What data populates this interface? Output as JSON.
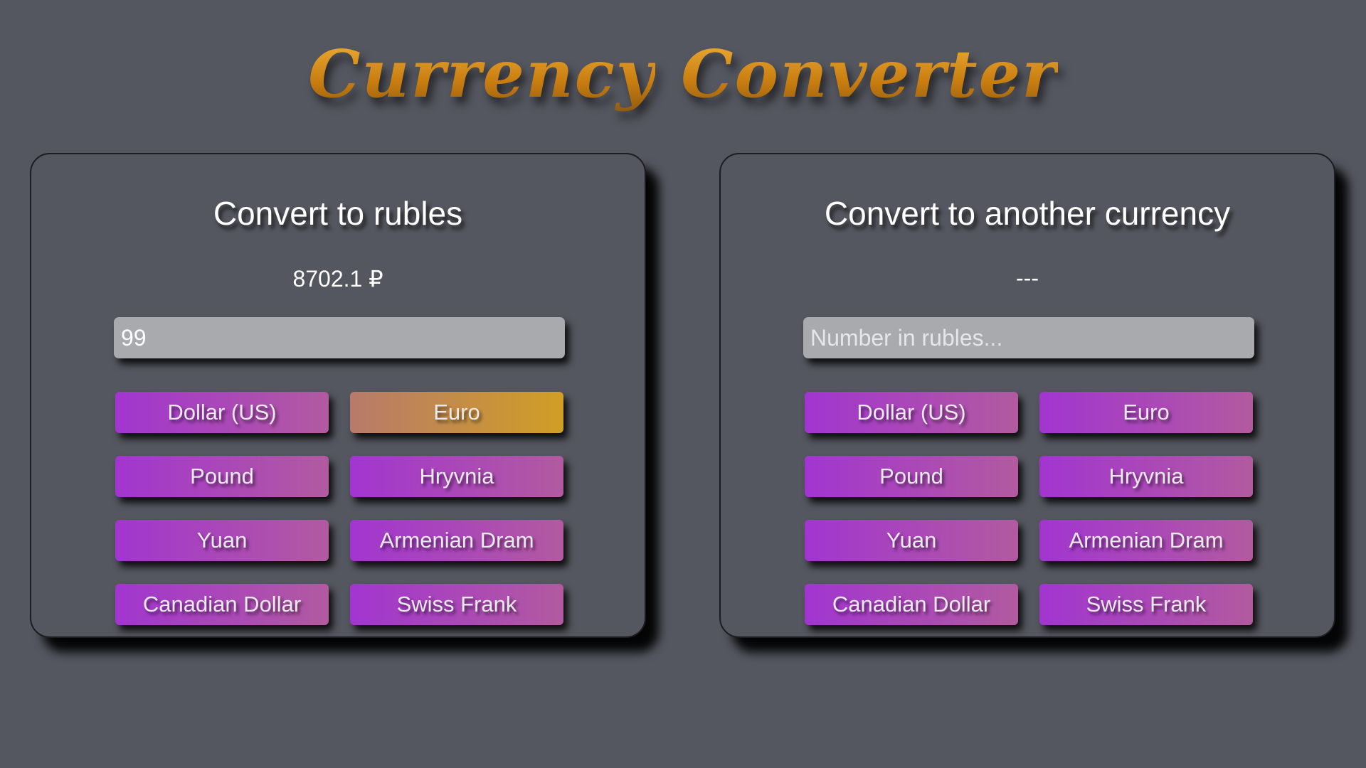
{
  "app": {
    "title_word1": "Currency",
    "title_word2": "Converter"
  },
  "to_rubles": {
    "heading": "Convert to rubles",
    "result": "8702.1 ₽",
    "input_value": "99",
    "input_placeholder": "",
    "buttons": [
      {
        "label": "Dollar (US)"
      },
      {
        "label": "Euro",
        "selected": true
      },
      {
        "label": "Pound"
      },
      {
        "label": "Hryvnia"
      },
      {
        "label": "Yuan"
      },
      {
        "label": "Armenian Dram"
      },
      {
        "label": "Canadian Dollar"
      },
      {
        "label": "Swiss Frank"
      }
    ]
  },
  "to_other": {
    "heading": "Convert to another currency",
    "result": "---",
    "input_value": "",
    "input_placeholder": "Number in rubles...",
    "buttons": [
      {
        "label": "Dollar (US)"
      },
      {
        "label": "Euro"
      },
      {
        "label": "Pound"
      },
      {
        "label": "Hryvnia"
      },
      {
        "label": "Yuan"
      },
      {
        "label": "Armenian Dram"
      },
      {
        "label": "Canadian Dollar"
      },
      {
        "label": "Swiss Frank"
      }
    ]
  },
  "colors": {
    "background": "#54575f",
    "title_gold": "#e59a22",
    "button_purple": "#a235d0",
    "button_pink": "#b25aa0",
    "selected_tan": "#b87a6b",
    "selected_gold": "#d09f24",
    "input_gray": "#a9aaae"
  }
}
